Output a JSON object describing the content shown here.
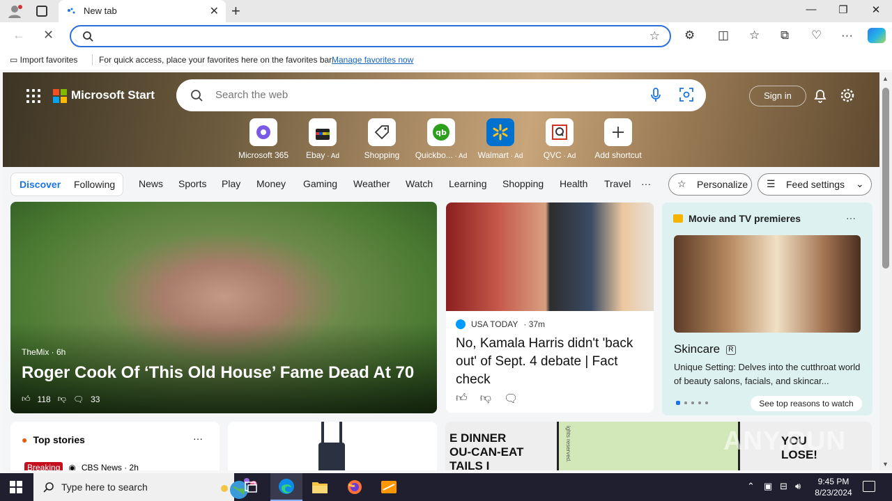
{
  "browser": {
    "tab_title": "New tab",
    "newtab_glyph": "+",
    "close_glyph": "✕",
    "win_minimize": "—",
    "win_restore": "❐",
    "win_close": "✕",
    "favorites_bar": {
      "import_label": "Import favorites",
      "message": "For quick access, place your favorites here on the favorites bar.",
      "manage_link": "Manage favorites now"
    }
  },
  "start": {
    "brand": "Microsoft Start",
    "search_placeholder": "Search the web",
    "sign_in": "Sign in",
    "shortcuts": [
      {
        "label": "Microsoft 365",
        "ad": ""
      },
      {
        "label": "Ebay",
        "ad": " · Ad"
      },
      {
        "label": "Shopping",
        "ad": ""
      },
      {
        "label": "Quickbo...",
        "ad": " · Ad"
      },
      {
        "label": "Walmart",
        "ad": " · Ad"
      },
      {
        "label": "QVC",
        "ad": " · Ad"
      },
      {
        "label": "Add shortcut",
        "ad": ""
      }
    ],
    "feed_tabs": [
      "Discover",
      "Following"
    ],
    "nav_items": [
      "News",
      "Sports",
      "Play",
      "Money",
      "Gaming",
      "Weather",
      "Watch",
      "Learning",
      "Shopping",
      "Health",
      "Travel"
    ],
    "nav_more": "···",
    "personalize": "Personalize",
    "feed_settings": "Feed settings"
  },
  "cards": {
    "main": {
      "source": "TheMix · 6h",
      "title": "Roger Cook Of ‘This Old House’ Fame Dead At 70",
      "likes": "118",
      "comments": "33"
    },
    "middle": {
      "source": "USA TODAY",
      "age": "· 37m",
      "title": "No, Kamala Harris didn't 'back out' of Sept. 4 debate | Fact check"
    },
    "side": {
      "heading": "Movie and TV premieres",
      "more": "···",
      "name": "Skincare",
      "rating": "R",
      "description": "Unique Setting: Delves into the cutthroat world of beauty salons, facials, and skincar...",
      "cta": "See top reasons to watch"
    },
    "top_stories": {
      "heading": "Top stories",
      "more": "···",
      "badge": "Breaking",
      "source": "CBS News · 2h"
    },
    "comic": {
      "left_text": "E DINNER\nOU-CAN-EAT\nTAILS I",
      "right_text": "YOU\nLOSE!",
      "copyright": "ights reserved."
    }
  },
  "watermark": "ANY.RUN",
  "taskbar": {
    "search_placeholder": "Type here to search",
    "time": "9:45 PM",
    "date": "8/23/2024"
  },
  "colors": {
    "accent": "#1a73e8",
    "address_border": "#2a6fdb",
    "breaking": "#c50f1f",
    "side_card_bg": "#ddf2f0"
  }
}
